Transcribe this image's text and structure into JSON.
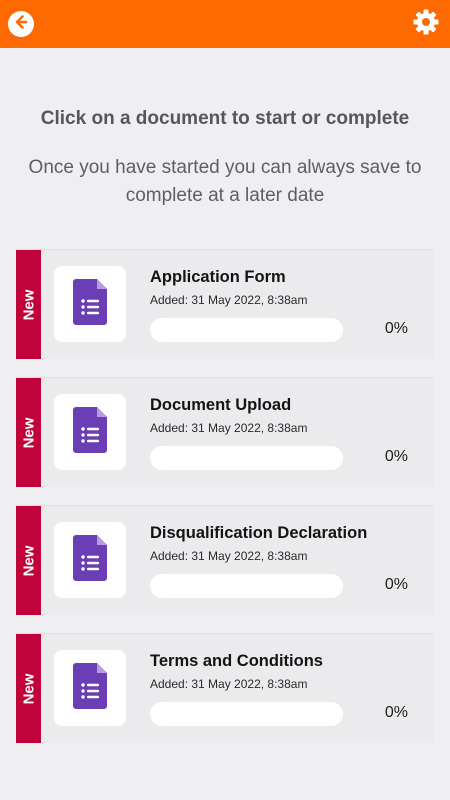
{
  "header": {
    "back_icon": "arrow-left-icon",
    "settings_icon": "gear-icon",
    "accent_color": "#ff6a00"
  },
  "main": {
    "heading": "Click on a document to start or complete",
    "subheading": "Once you have started you can always save to complete at a later date"
  },
  "documents": [
    {
      "badge": "New",
      "icon": "document-form-icon",
      "title": "Application Form",
      "added": "Added: 31 May 2022, 8:38am",
      "progress": 0,
      "progress_label": "0%"
    },
    {
      "badge": "New",
      "icon": "document-form-icon",
      "title": "Document Upload",
      "added": "Added: 31 May 2022, 8:38am",
      "progress": 0,
      "progress_label": "0%"
    },
    {
      "badge": "New",
      "icon": "document-form-icon",
      "title": "Disqualification Declaration",
      "added": "Added: 31 May 2022, 8:38am",
      "progress": 0,
      "progress_label": "0%"
    },
    {
      "badge": "New",
      "icon": "document-form-icon",
      "title": "Terms and Conditions",
      "added": "Added: 31 May 2022, 8:38am",
      "progress": 0,
      "progress_label": "0%"
    }
  ],
  "colors": {
    "badge": "#c0033b",
    "doc_icon": "#6a3fb6"
  }
}
